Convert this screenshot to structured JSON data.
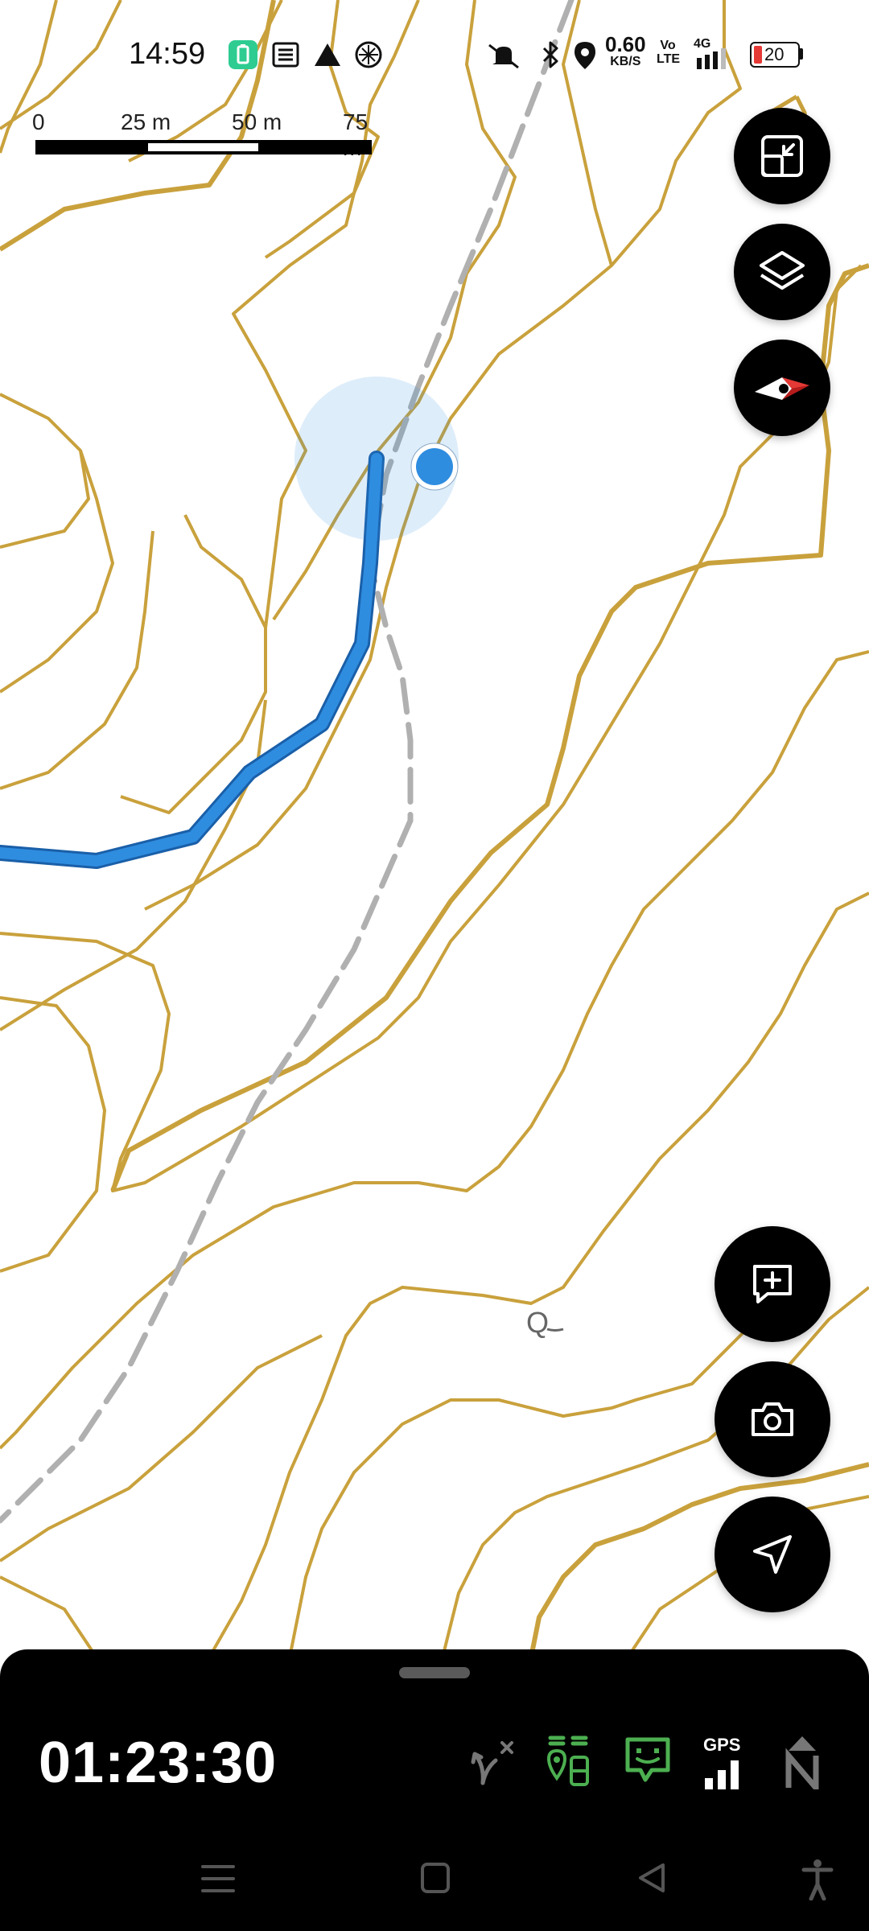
{
  "status_bar": {
    "time": "14:59",
    "net_speed_value": "0.60",
    "net_speed_unit": "KB/S",
    "volte": "Vo LTE",
    "network": "4G",
    "battery": "20",
    "icons": [
      "battery-saver-icon",
      "news-icon",
      "warning-icon",
      "soccer-ball-icon",
      "mute-icon",
      "bluetooth-icon",
      "location-icon",
      "signal-icon",
      "battery-icon"
    ]
  },
  "scale_bar": {
    "labels": [
      "0",
      "25 m",
      "50 m",
      "75 m"
    ]
  },
  "map": {
    "contour_color": "#c9a13c",
    "track_color": "#2f8de0",
    "trail_color": "#b0b0b0",
    "location_color": "#2f8de0",
    "label": "Q"
  },
  "map_controls": [
    "map-orientation-button",
    "layers-button",
    "compass-button"
  ],
  "fab_actions": [
    "add-note-button",
    "camera-button",
    "navigate-button"
  ],
  "bottom_panel": {
    "timer": "01:23:30",
    "gps_label": "GPS",
    "status_icons": [
      "route-off-icon",
      "waypoints-icon",
      "message-icon",
      "gps-signal-icon",
      "north-up-icon"
    ],
    "accent_color": "#4caf50"
  },
  "nav_bar": [
    "menu-button",
    "home-button",
    "back-button",
    "accessibility-button"
  ]
}
